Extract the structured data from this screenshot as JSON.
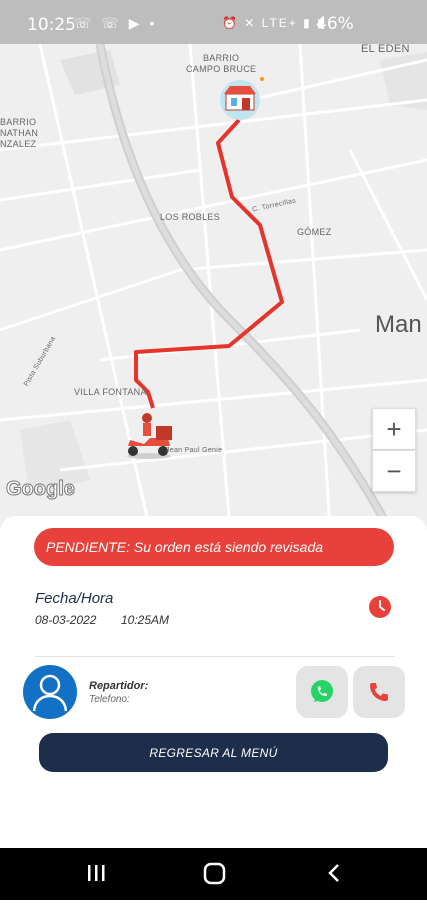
{
  "status_bar": {
    "time": "10:25",
    "left_icons": "☏ ☏ ▶ •",
    "right_icons": "⏰ ✕ LTE+ ▮ ▮",
    "battery": "46%"
  },
  "map": {
    "labels": {
      "barrio_campo_bruce": "BARRIO\nCAMPO BRUCE",
      "el_eden": "EL EDEN",
      "barrio_jonathan": "BARRIO\nNATHAN\nNZALEZ",
      "los_robles": "LOS ROBLES",
      "c_torrecillas": "C. Torrecillas",
      "gomez": "GÓMEZ",
      "managua": "Man",
      "villa_fontana": "VILLA FONTANA",
      "pista_jean_paul": "Jean Paul Genie",
      "pista_suburbana": "Pista Suburbana"
    },
    "zoom_in": "+",
    "zoom_out": "−",
    "google": "Google"
  },
  "order": {
    "status_text": "PENDIENTE: Su orden está siendo revisada",
    "status_color": "#e8403a",
    "fecha_label": "Fecha/Hora",
    "fecha": "08-03-2022",
    "hora": "10:25AM"
  },
  "courier": {
    "label": "Repartidor:",
    "telefono_label": "Telefono:"
  },
  "actions": {
    "menu_button": "REGRESAR AL MENÚ"
  },
  "colors": {
    "primary": "#1c2e4a",
    "accent": "#e8403a",
    "whatsapp": "#25d366"
  }
}
